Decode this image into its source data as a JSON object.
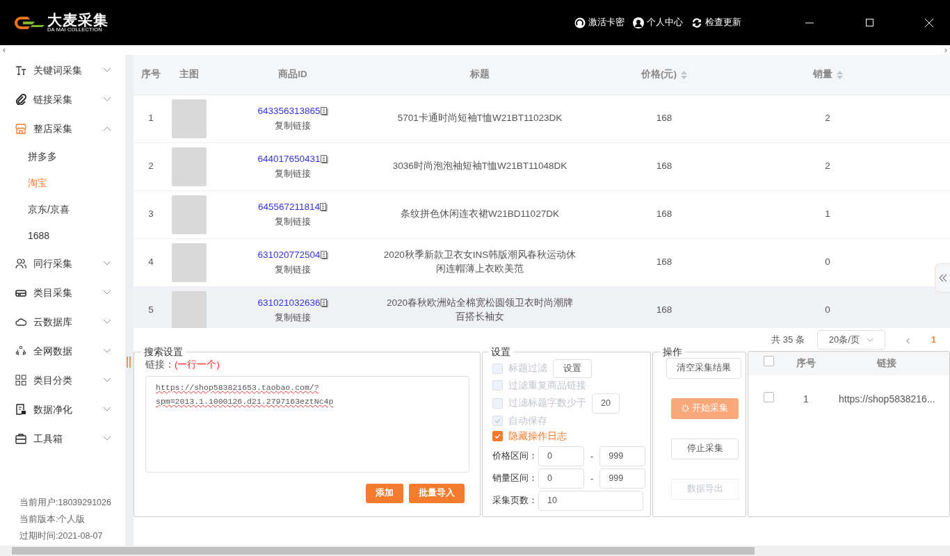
{
  "header": {
    "logo_text": "大麦采集",
    "logo_sub": "DA MAI COLLECTION",
    "links": [
      {
        "label": "激活卡密"
      },
      {
        "label": "个人中心"
      },
      {
        "label": "检查更新"
      }
    ]
  },
  "strip": {
    "left": "‹",
    "right": "›"
  },
  "sidebar": {
    "items": [
      {
        "label": "关键词采集",
        "expanded": false
      },
      {
        "label": "链接采集",
        "expanded": false
      },
      {
        "label": "整店采集",
        "expanded": true,
        "children": [
          {
            "label": "拼多多",
            "selected": false
          },
          {
            "label": "淘宝",
            "selected": true
          },
          {
            "label": "京东/京喜",
            "selected": false
          },
          {
            "label": "1688",
            "selected": false
          }
        ]
      },
      {
        "label": "同行采集",
        "expanded": false
      },
      {
        "label": "类目采集",
        "expanded": false
      },
      {
        "label": "云数据库",
        "expanded": false
      },
      {
        "label": "全网数据",
        "expanded": false
      },
      {
        "label": "类目分类",
        "expanded": false
      },
      {
        "label": "数据净化",
        "expanded": false
      },
      {
        "label": "工具箱",
        "expanded": false
      }
    ],
    "footer": [
      "当前用户:18039291026",
      "当前版本:个人版",
      "过期时间:2021-08-07"
    ]
  },
  "table": {
    "columns": [
      {
        "label": "序号",
        "sortable": false
      },
      {
        "label": "主图",
        "sortable": false
      },
      {
        "label": "商品ID",
        "sortable": false
      },
      {
        "label": "标题",
        "sortable": false
      },
      {
        "label": "价格(元)",
        "sortable": true
      },
      {
        "label": "销量",
        "sortable": true
      }
    ],
    "rows": [
      {
        "no": "1",
        "id": "643356313865",
        "copy": "复制链接",
        "title": "5701卡通时尚短袖T恤W21BT11023DK",
        "price": "168",
        "sales": "2",
        "hovered": false
      },
      {
        "no": "2",
        "id": "644017650431",
        "copy": "复制链接",
        "title": "3036时尚泡泡袖短袖T恤W21BT11048DK",
        "price": "168",
        "sales": "2",
        "hovered": false
      },
      {
        "no": "3",
        "id": "645567211814",
        "copy": "复制链接",
        "title": "条纹拼色休闲连衣裙W21BD11027DK",
        "price": "168",
        "sales": "1",
        "hovered": false
      },
      {
        "no": "4",
        "id": "631020772504",
        "copy": "复制链接",
        "title": "2020秋季新款卫衣女INS韩版潮风春秋运动休闲连帽薄上衣欧美范",
        "price": "168",
        "sales": "0",
        "hovered": false
      },
      {
        "no": "5",
        "id": "631021032636",
        "copy": "复制链接",
        "title": "2020春秋欧洲站全棉宽松圆领卫衣时尚潮牌百搭长袖女",
        "price": "168",
        "sales": "0",
        "hovered": true
      }
    ]
  },
  "pagination": {
    "total": "共 35 条",
    "page_size": "20条/页",
    "prev": "‹",
    "pages": [
      {
        "label": "1",
        "selected": true
      }
    ]
  },
  "search_settings": {
    "legend": "搜索设置",
    "link_label": "链接：",
    "link_hint": "(一行一个)",
    "links_value": "https://shop583821653.taobao.com/?spm=2013.1.1000126.d21.2797163eztNc4p",
    "buttons": [
      "添加",
      "批量导入"
    ]
  },
  "settings": {
    "legend": "设置",
    "options": [
      {
        "kind": "button",
        "label": "标题过滤",
        "checked": false,
        "disabled": true,
        "extra": "设置"
      },
      {
        "kind": "plain",
        "label": "过滤重复商品链接",
        "checked": false,
        "disabled": true
      },
      {
        "kind": "input",
        "label": "过滤标题字数少于",
        "checked": false,
        "disabled": true,
        "extra": "20"
      },
      {
        "kind": "plain",
        "label": "自动保存",
        "checked": true,
        "disabled": true
      },
      {
        "kind": "plain",
        "label": "隐藏操作日志",
        "checked": true,
        "disabled": false
      }
    ],
    "fields": [
      {
        "label": "价格区间：",
        "kind": "range",
        "from": "0",
        "sep": "-",
        "to": "999"
      },
      {
        "label": "销量区间：",
        "kind": "range",
        "from": "0",
        "sep": "-",
        "to": "999"
      },
      {
        "label": "采集页数：",
        "kind": "single",
        "from": "10"
      }
    ]
  },
  "operations": {
    "legend": "操作",
    "buttons": [
      {
        "label": "清空采集结果",
        "kind": "default",
        "loading": false,
        "disabled": false
      },
      {
        "label": "开始采集",
        "kind": "primary",
        "loading": true,
        "disabled": false
      },
      {
        "label": "停止采集",
        "kind": "default",
        "loading": false,
        "disabled": false
      },
      {
        "label": "数据导出",
        "kind": "default",
        "loading": false,
        "disabled": true
      }
    ]
  },
  "results": {
    "columns": [
      "序号",
      "链接"
    ],
    "header_checked": false,
    "rows": [
      {
        "no": "1",
        "link": "https://shop5838216...",
        "checked": false
      }
    ]
  }
}
